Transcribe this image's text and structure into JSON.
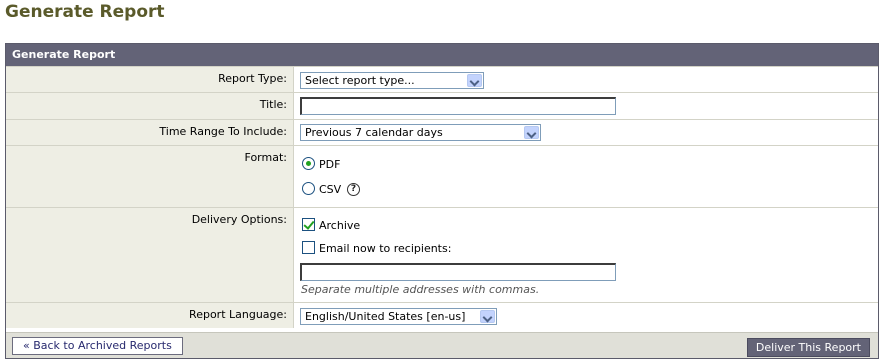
{
  "page": {
    "title": "Generate Report"
  },
  "panel": {
    "header": "Generate Report"
  },
  "fields": {
    "report_type": {
      "label": "Report Type:",
      "value": "Select report type..."
    },
    "title": {
      "label": "Title:",
      "value": ""
    },
    "time_range": {
      "label": "Time Range To Include:",
      "value": "Previous 7 calendar days"
    },
    "format": {
      "label": "Format:",
      "options": [
        {
          "label": "PDF",
          "checked": true
        },
        {
          "label": "CSV",
          "checked": false
        }
      ],
      "help_icon": "question-icon"
    },
    "delivery": {
      "label": "Delivery Options:",
      "archive_label": "Archive",
      "archive_checked": true,
      "email_label": "Email now to recipients:",
      "email_checked": false,
      "email_value": "",
      "hint": "Separate multiple addresses with commas."
    },
    "language": {
      "label": "Report Language:",
      "value": "English/United States [en-us]"
    }
  },
  "footer": {
    "back_label": "« Back to Archived Reports",
    "deliver_label": "Deliver This Report"
  },
  "colors": {
    "title": "#5a5a2a",
    "header_bg": "#636377",
    "label_bg": "#eeeee4",
    "accent_green": "#21a121"
  }
}
